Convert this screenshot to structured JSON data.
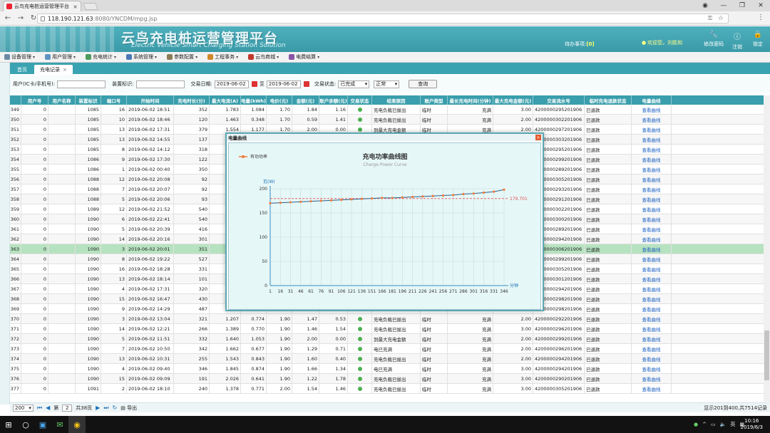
{
  "browser": {
    "tab_title": "云鸟充电桩运营管理平台",
    "url_host": "118.190.121.63",
    "url_path": ":8080/YNCDM/mpg.jsp"
  },
  "header": {
    "title": "云鸟充电桩运营管理平台",
    "subtitle": "Electric Vehicle Smart Charging Station Solution",
    "todo_label": "待办事项:",
    "todo_count": "[0]",
    "welcome": "欢迎您，刘胜和",
    "tools": [
      {
        "label": "修改密码",
        "icon": "wrench-icon"
      },
      {
        "label": "注销",
        "icon": "info-icon"
      },
      {
        "label": "锁定",
        "icon": "lock-icon"
      }
    ]
  },
  "menu": [
    {
      "label": "设备管理",
      "color": "#6a8aa6"
    },
    {
      "label": "用户管理",
      "color": "#5f93c2"
    },
    {
      "label": "充电统计",
      "color": "#4d9a5c"
    },
    {
      "label": "系统管理",
      "color": "#4a79b5"
    },
    {
      "label": "参数配置",
      "color": "#8a7c57"
    },
    {
      "label": "工程事务",
      "color": "#d0872c"
    },
    {
      "label": "云鸟商城",
      "color": "#c0392b"
    },
    {
      "label": "电费结算",
      "color": "#8a55a5"
    }
  ],
  "tabs": [
    {
      "label": "首页",
      "active": false
    },
    {
      "label": "充电记录",
      "active": true
    }
  ],
  "filter": {
    "user_label": "用户(IC卡/手机号):",
    "device_label": "装置标识:",
    "date_label": "交易日期:",
    "date_from": "2019-06-02",
    "to_label": "至",
    "date_to": "2019-06-02",
    "status_label": "交易状态:",
    "status_value": "已完成",
    "type_value": "正常",
    "query_btn": "查询"
  },
  "columns": [
    "",
    "用户号",
    "用户名称",
    "装置标识",
    "端口号",
    "开始时间",
    "充电时长(分)",
    "最大电流(A)",
    "电量(kWh)",
    "电价(元)",
    "金额(元)",
    "账户余额(元)",
    "交易状态",
    "结束原因",
    "账户类型",
    "最长充电时间(分钟)",
    "最大充电金额(元)",
    "交易流水号",
    "临时充电退款状态",
    "电量曲线"
  ],
  "rows": [
    [
      "349",
      "0",
      "",
      "1085",
      "16",
      "2019-06-02 18:51",
      "352",
      "1.783",
      "1.084",
      "1.70",
      "1.84",
      "1.16",
      "ok",
      "充电负载已拔出",
      "临时",
      "充满",
      "3.00",
      "4200000295201906",
      "已退款",
      "查看曲线"
    ],
    [
      "350",
      "0",
      "",
      "1085",
      "10",
      "2019-06-02 18:46",
      "120",
      "1.463",
      "0.348",
      "1.70",
      "0.59",
      "1.41",
      "ok",
      "充电负载已拔出",
      "临时",
      "充满",
      "2.00",
      "4200000302201906",
      "已退款",
      "查看曲线"
    ],
    [
      "351",
      "0",
      "",
      "1085",
      "13",
      "2019-06-02 17:31",
      "379",
      "1.554",
      "1.177",
      "1.70",
      "2.00",
      "0.00",
      "ok",
      "到最大充电金额",
      "临时",
      "充满",
      "2.00",
      "4200000297201906",
      "已退款",
      "查看曲线"
    ],
    [
      "352",
      "0",
      "",
      "1085",
      "13",
      "2019-06-02 14:55",
      "137",
      "",
      "",
      "",
      "",
      "",
      "",
      "",
      "",
      "",
      "",
      "4200000303201906",
      "已退款",
      "查看曲线"
    ],
    [
      "353",
      "0",
      "",
      "1085",
      "8",
      "2019-06-02 14:12",
      "318",
      "",
      "",
      "",
      "",
      "",
      "",
      "",
      "",
      "",
      "",
      "4200000295201906",
      "已退款",
      "查看曲线"
    ],
    [
      "354",
      "0",
      "",
      "1086",
      "9",
      "2019-06-02 17:30",
      "122",
      "",
      "",
      "",
      "",
      "",
      "",
      "",
      "",
      "",
      "",
      "4200000299201906",
      "已退款",
      "查看曲线"
    ],
    [
      "355",
      "0",
      "",
      "1086",
      "1",
      "2019-06-02 00:40",
      "350",
      "",
      "",
      "",
      "",
      "",
      "",
      "",
      "",
      "",
      "",
      "4200000289201906",
      "已退款",
      "查看曲线"
    ],
    [
      "356",
      "0",
      "",
      "1088",
      "12",
      "2019-06-02 20:08",
      "92",
      "",
      "",
      "",
      "",
      "",
      "",
      "",
      "",
      "",
      "",
      "4200000305201906",
      "已退款",
      "查看曲线"
    ],
    [
      "357",
      "0",
      "",
      "1088",
      "7",
      "2019-06-02 20:07",
      "92",
      "",
      "",
      "",
      "",
      "",
      "",
      "",
      "",
      "",
      "",
      "4200000293201906",
      "已退款",
      "查看曲线"
    ],
    [
      "358",
      "0",
      "",
      "1088",
      "5",
      "2019-06-02 20:06",
      "93",
      "",
      "",
      "",
      "",
      "",
      "",
      "",
      "",
      "",
      "",
      "4200000291201906",
      "已退款",
      "查看曲线"
    ],
    [
      "359",
      "0",
      "",
      "1089",
      "12",
      "2019-06-02 21:52",
      "540",
      "",
      "",
      "",
      "",
      "",
      "",
      "",
      "",
      "",
      "",
      "4200000302201906",
      "已退款",
      "查看曲线"
    ],
    [
      "360",
      "0",
      "",
      "1090",
      "6",
      "2019-06-02 22:41",
      "540",
      "",
      "",
      "",
      "",
      "",
      "",
      "",
      "",
      "",
      "",
      "4200000300201906",
      "已退款",
      "查看曲线"
    ],
    [
      "361",
      "0",
      "",
      "1090",
      "5",
      "2019-06-02 20:39",
      "416",
      "",
      "",
      "",
      "",
      "",
      "",
      "",
      "",
      "",
      "",
      "4200000289201906",
      "已退款",
      "查看曲线"
    ],
    [
      "362",
      "0",
      "",
      "1090",
      "14",
      "2019-06-02 20:16",
      "301",
      "",
      "",
      "",
      "",
      "",
      "",
      "",
      "",
      "",
      "",
      "4200000294201906",
      "已退款",
      "查看曲线"
    ],
    [
      "363",
      "0",
      "",
      "1090",
      "3",
      "2019-06-02 20:01",
      "351",
      "",
      "",
      "",
      "",
      "",
      "",
      "",
      "",
      "",
      "",
      "4200000306201906",
      "已退款",
      "查看曲线"
    ],
    [
      "364",
      "0",
      "",
      "1090",
      "8",
      "2019-06-02 19:22",
      "527",
      "",
      "",
      "",
      "",
      "",
      "",
      "",
      "",
      "",
      "",
      "4200000299201906",
      "已退款",
      "查看曲线"
    ],
    [
      "365",
      "0",
      "",
      "1090",
      "16",
      "2019-06-02 18:28",
      "331",
      "",
      "",
      "",
      "",
      "",
      "",
      "",
      "",
      "",
      "",
      "4200000305201906",
      "已退款",
      "查看曲线"
    ],
    [
      "366",
      "0",
      "",
      "1090",
      "13",
      "2019-06-02 18:14",
      "101",
      "",
      "",
      "",
      "",
      "",
      "",
      "",
      "",
      "",
      "",
      "4200000301201906",
      "已退款",
      "查看曲线"
    ],
    [
      "367",
      "0",
      "",
      "1090",
      "4",
      "2019-06-02 17:31",
      "320",
      "",
      "",
      "",
      "",
      "",
      "",
      "",
      "",
      "",
      "",
      "4200000294201906",
      "已退款",
      "查看曲线"
    ],
    [
      "368",
      "0",
      "",
      "1090",
      "15",
      "2019-06-02 16:47",
      "430",
      "",
      "",
      "",
      "",
      "",
      "",
      "",
      "",
      "",
      "",
      "4200000298201906",
      "已退款",
      "查看曲线"
    ],
    [
      "369",
      "0",
      "",
      "1090",
      "9",
      "2019-06-02 14:29",
      "487",
      "",
      "",
      "",
      "",
      "",
      "",
      "",
      "",
      "",
      "",
      "4200000298201906",
      "已退款",
      "查看曲线"
    ],
    [
      "370",
      "0",
      "",
      "1090",
      "3",
      "2019-06-02 13:04",
      "321",
      "1.207",
      "0.774",
      "1.90",
      "1.47",
      "0.53",
      "ok",
      "充电负载已拔出",
      "临时",
      "充满",
      "2.00",
      "4200000292201906",
      "已退款",
      "查看曲线"
    ],
    [
      "371",
      "0",
      "",
      "1090",
      "14",
      "2019-06-02 12:21",
      "266",
      "1.389",
      "0.770",
      "1.90",
      "1.46",
      "1.54",
      "ok",
      "充电负载已拔出",
      "临时",
      "充满",
      "3.00",
      "4200000296201906",
      "已退款",
      "查看曲线"
    ],
    [
      "372",
      "0",
      "",
      "1090",
      "5",
      "2019-06-02 11:51",
      "332",
      "1.640",
      "1.053",
      "1.90",
      "2.00",
      "0.00",
      "ok",
      "到最大充电金额",
      "临时",
      "充满",
      "2.00",
      "4200000299201906",
      "已退款",
      "查看曲线"
    ],
    [
      "373",
      "0",
      "",
      "1090",
      "7",
      "2019-06-02 10:50",
      "342",
      "1.662",
      "0.677",
      "1.90",
      "1.29",
      "0.71",
      "ok",
      "电已充满",
      "临时",
      "充满",
      "2.00",
      "4200000296201906",
      "已退款",
      "查看曲线"
    ],
    [
      "374",
      "0",
      "",
      "1090",
      "13",
      "2019-06-02 10:31",
      "255",
      "1.543",
      "0.843",
      "1.90",
      "1.60",
      "0.40",
      "ok",
      "充电负载已拔出",
      "临时",
      "充满",
      "2.00",
      "4200000294201906",
      "已退款",
      "查看曲线"
    ],
    [
      "375",
      "0",
      "",
      "1090",
      "4",
      "2019-06-02 09:40",
      "346",
      "1.845",
      "0.874",
      "1.90",
      "1.66",
      "1.34",
      "ok",
      "电已充满",
      "临时",
      "充满",
      "3.00",
      "4200000294201906",
      "已退款",
      "查看曲线"
    ],
    [
      "376",
      "0",
      "",
      "1090",
      "15",
      "2019-06-02 09:09",
      "191",
      "2.026",
      "0.641",
      "1.90",
      "1.22",
      "1.78",
      "ok",
      "充电负载已拔出",
      "临时",
      "充满",
      "3.00",
      "4200000290201906",
      "已退款",
      "查看曲线"
    ],
    [
      "377",
      "0",
      "",
      "1091",
      "2",
      "2019-06-02 18:10",
      "240",
      "1.378",
      "0.771",
      "2.00",
      "1.54",
      "1.46",
      "ok",
      "充电负载已拔出",
      "临时",
      "充满",
      "3.00",
      "4200000305201906",
      "已退款",
      "查看曲线"
    ]
  ],
  "selected_row": "363",
  "pager": {
    "page_size": "200",
    "page_label": "第",
    "page": "2",
    "page_total": "共38页",
    "export": "导出",
    "total": "显示201到400,共7514记录"
  },
  "modal": {
    "title": "电量曲线",
    "close": "×"
  },
  "chart_data": {
    "type": "line",
    "title": "充电功率曲线图",
    "subtitle": "Charge Power Curve",
    "ylabel": "瓦(W)",
    "xlabel": "分钟",
    "ylim": [
      0,
      200
    ],
    "yticks": [
      0,
      50,
      100,
      150,
      200
    ],
    "legend": "有功功率",
    "legend_position": "top-left",
    "grid": true,
    "avg_label": "179.701",
    "avg_value": 179.701,
    "x": [
      1,
      16,
      31,
      46,
      61,
      76,
      91,
      106,
      121,
      136,
      151,
      166,
      181,
      196,
      211,
      226,
      241,
      256,
      271,
      286,
      301,
      316,
      331,
      346
    ],
    "series": [
      {
        "name": "有功功率",
        "color": "#f07c3a",
        "values": [
          170,
          171,
          172,
          173,
          174,
          175,
          176,
          177,
          178,
          179,
          180,
          181,
          181,
          182,
          183,
          184,
          185,
          186,
          187,
          189,
          190,
          192,
          194,
          198
        ]
      }
    ]
  },
  "taskbar": {
    "time": "10:16",
    "date": "2019/6/3",
    "lang": "英"
  }
}
